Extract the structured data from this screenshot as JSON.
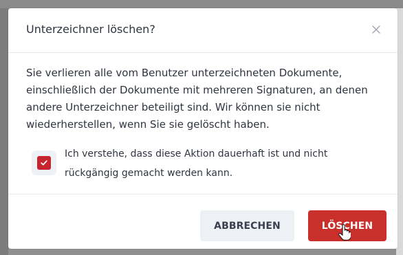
{
  "dialog": {
    "title": "Unterzeichner löschen?",
    "message": "Sie verlieren alle vom Benutzer unterzeichneten Dokumente, einschließlich der Dokumente mit mehreren Signaturen, an denen andere Unterzeichner beteiligt sind. Wir können sie nicht wiederherstellen, wenn Sie sie gelöscht haben.",
    "confirmation": {
      "label": "Ich verstehe, dass diese Aktion dauerhaft ist und nicht rückgängig gemacht werden kann.",
      "checked": true
    },
    "buttons": {
      "cancel": "ABBRECHEN",
      "delete": "LÖSCHEN"
    }
  },
  "colors": {
    "accent": "#c9302c",
    "checkbox": "#c6242f",
    "text": "#2f3440",
    "secondary_button": "#edf0f5"
  },
  "icons": {
    "close": "close-icon",
    "check": "check-icon",
    "cursor": "hand-cursor-icon"
  }
}
